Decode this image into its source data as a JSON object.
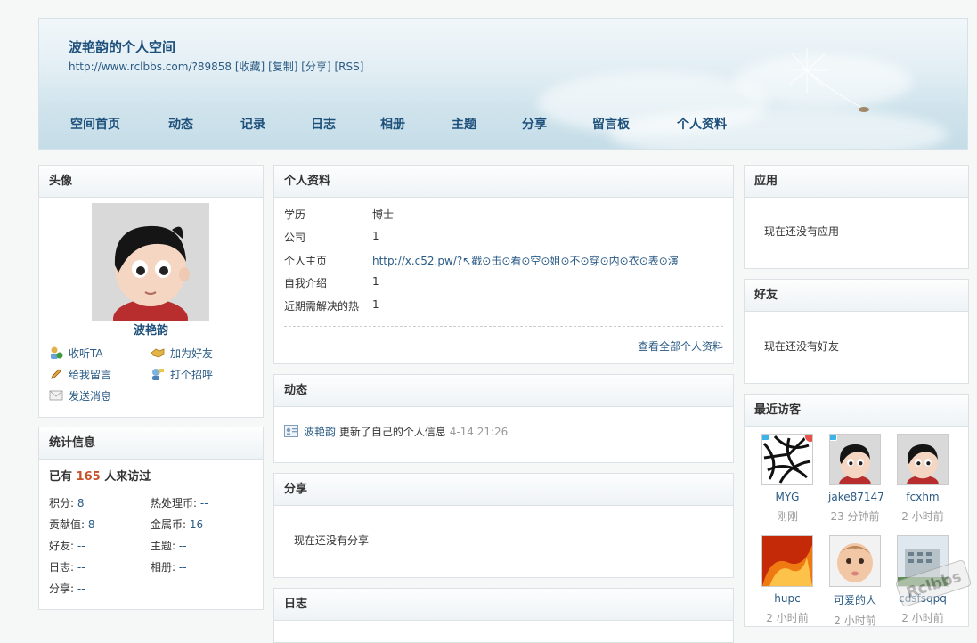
{
  "header": {
    "title": "波艳韵的个人空间",
    "url": "http://www.rclbbs.com/?89858",
    "links": [
      "[收藏]",
      "[复制]",
      "[分享]",
      "[RSS]"
    ],
    "nav": [
      "空间首页",
      "动态",
      "记录",
      "日志",
      "相册",
      "主题",
      "分享",
      "留言板",
      "个人资料"
    ]
  },
  "avatar_box": {
    "title": "头像",
    "username": "波艳韵",
    "actions": [
      "收听TA",
      "加为好友",
      "给我留言",
      "打个招呼",
      "发送消息"
    ]
  },
  "stats_box": {
    "title": "统计信息",
    "visits_prefix": "已有",
    "visits_count": "165",
    "visits_suffix": "人来访过",
    "items": [
      {
        "label": "积分:",
        "value": "8"
      },
      {
        "label": "热处理币:",
        "value": "--"
      },
      {
        "label": "贡献值:",
        "value": "8"
      },
      {
        "label": "金属币:",
        "value": "16"
      },
      {
        "label": "好友:",
        "value": "--"
      },
      {
        "label": "主题:",
        "value": "--"
      },
      {
        "label": "日志:",
        "value": "--"
      },
      {
        "label": "相册:",
        "value": "--"
      },
      {
        "label": "分享:",
        "value": "--"
      }
    ]
  },
  "profile_box": {
    "title": "个人资料",
    "rows": [
      {
        "label": "学历",
        "value": "博士"
      },
      {
        "label": "公司",
        "value": "1"
      },
      {
        "label": "个人主页",
        "value": "http://x.c52.pw/?↖戳⊙击⊙看⊙空⊙姐⊙不⊙穿⊙内⊙衣⊙表⊙演"
      },
      {
        "label": "自我介绍",
        "value": "1"
      },
      {
        "label": "近期需解决的热",
        "value": "1"
      }
    ],
    "view_all": "查看全部个人资料"
  },
  "feed_box": {
    "title": "动态",
    "user": "波艳韵",
    "action": "更新了自己的个人信息",
    "time": "4-14 21:26"
  },
  "share_box": {
    "title": "分享",
    "empty": "现在还没有分享"
  },
  "blog_box": {
    "title": "日志"
  },
  "apps_box": {
    "title": "应用",
    "empty": "现在还没有应用"
  },
  "friends_box": {
    "title": "好友",
    "empty": "现在还没有好友"
  },
  "visitors_box": {
    "title": "最近访客",
    "visitors": [
      {
        "name": "MYG",
        "time": "刚刚"
      },
      {
        "name": "jake87147",
        "time": "23 分钟前"
      },
      {
        "name": "fcxhm",
        "time": "2 小时前"
      },
      {
        "name": "hupc",
        "time": "2 小时前"
      },
      {
        "name": "可爱的人",
        "time": "2 小时前"
      },
      {
        "name": "cdsfsqpq",
        "time": "2 小时前"
      }
    ]
  },
  "watermark": "Rclbbs",
  "colors": {
    "accent": "#1c4f7a",
    "link": "#2a5b84",
    "count": "#c6522b"
  }
}
